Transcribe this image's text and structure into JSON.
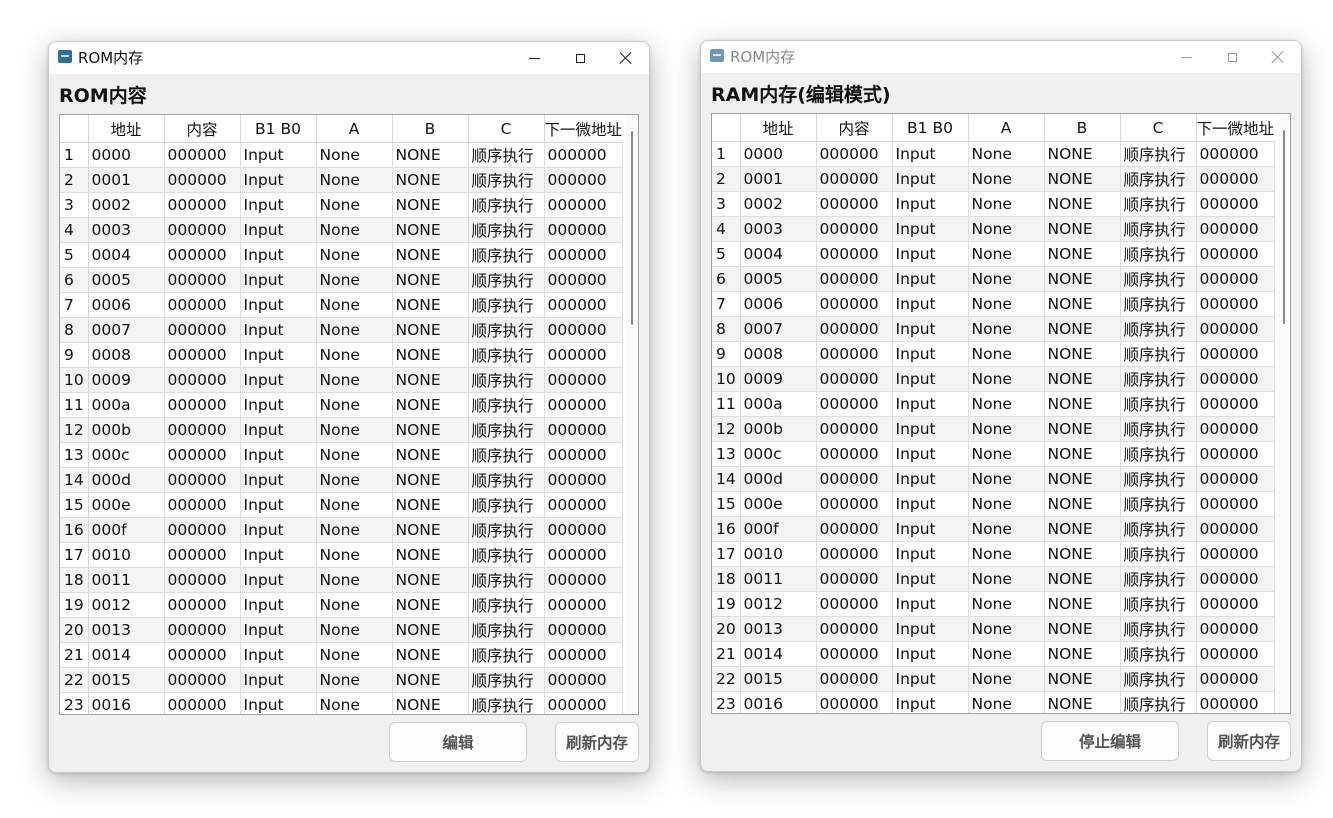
{
  "rom_window": {
    "title": "ROM内存",
    "heading": "ROM内容",
    "edit_button": "编辑",
    "refresh_button": "刷新内存"
  },
  "ram_window": {
    "title": "ROM内存",
    "heading": "RAM内存(编辑模式)",
    "stop_edit_button": "停止编辑",
    "refresh_button": "刷新内存"
  },
  "table": {
    "columns": [
      "地址",
      "内容",
      "B1 B0",
      "A",
      "B",
      "C",
      "下一微地址"
    ],
    "rows": [
      [
        "1",
        "0000",
        "000000",
        "Input",
        "None",
        "NONE",
        "顺序执行",
        "000000"
      ],
      [
        "2",
        "0001",
        "000000",
        "Input",
        "None",
        "NONE",
        "顺序执行",
        "000000"
      ],
      [
        "3",
        "0002",
        "000000",
        "Input",
        "None",
        "NONE",
        "顺序执行",
        "000000"
      ],
      [
        "4",
        "0003",
        "000000",
        "Input",
        "None",
        "NONE",
        "顺序执行",
        "000000"
      ],
      [
        "5",
        "0004",
        "000000",
        "Input",
        "None",
        "NONE",
        "顺序执行",
        "000000"
      ],
      [
        "6",
        "0005",
        "000000",
        "Input",
        "None",
        "NONE",
        "顺序执行",
        "000000"
      ],
      [
        "7",
        "0006",
        "000000",
        "Input",
        "None",
        "NONE",
        "顺序执行",
        "000000"
      ],
      [
        "8",
        "0007",
        "000000",
        "Input",
        "None",
        "NONE",
        "顺序执行",
        "000000"
      ],
      [
        "9",
        "0008",
        "000000",
        "Input",
        "None",
        "NONE",
        "顺序执行",
        "000000"
      ],
      [
        "10",
        "0009",
        "000000",
        "Input",
        "None",
        "NONE",
        "顺序执行",
        "000000"
      ],
      [
        "11",
        "000a",
        "000000",
        "Input",
        "None",
        "NONE",
        "顺序执行",
        "000000"
      ],
      [
        "12",
        "000b",
        "000000",
        "Input",
        "None",
        "NONE",
        "顺序执行",
        "000000"
      ],
      [
        "13",
        "000c",
        "000000",
        "Input",
        "None",
        "NONE",
        "顺序执行",
        "000000"
      ],
      [
        "14",
        "000d",
        "000000",
        "Input",
        "None",
        "NONE",
        "顺序执行",
        "000000"
      ],
      [
        "15",
        "000e",
        "000000",
        "Input",
        "None",
        "NONE",
        "顺序执行",
        "000000"
      ],
      [
        "16",
        "000f",
        "000000",
        "Input",
        "None",
        "NONE",
        "顺序执行",
        "000000"
      ],
      [
        "17",
        "0010",
        "000000",
        "Input",
        "None",
        "NONE",
        "顺序执行",
        "000000"
      ],
      [
        "18",
        "0011",
        "000000",
        "Input",
        "None",
        "NONE",
        "顺序执行",
        "000000"
      ],
      [
        "19",
        "0012",
        "000000",
        "Input",
        "None",
        "NONE",
        "顺序执行",
        "000000"
      ],
      [
        "20",
        "0013",
        "000000",
        "Input",
        "None",
        "NONE",
        "顺序执行",
        "000000"
      ],
      [
        "21",
        "0014",
        "000000",
        "Input",
        "None",
        "NONE",
        "顺序执行",
        "000000"
      ],
      [
        "22",
        "0015",
        "000000",
        "Input",
        "None",
        "NONE",
        "顺序执行",
        "000000"
      ],
      [
        "23",
        "0016",
        "000000",
        "Input",
        "None",
        "NONE",
        "顺序执行",
        "000000"
      ]
    ]
  }
}
